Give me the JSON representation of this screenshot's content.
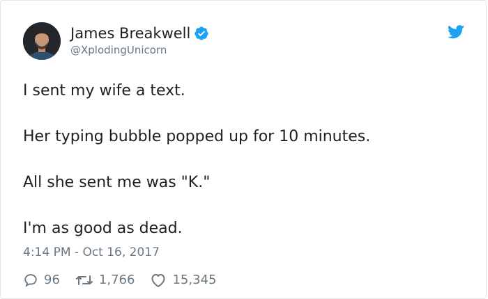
{
  "author": {
    "display_name": "James Breakwell",
    "handle": "@XplodingUnicorn",
    "verified": true
  },
  "tweet": {
    "lines": [
      "I sent my wife a text.",
      "Her typing bubble popped up for 10 minutes.",
      "All she sent me was \"K.\"",
      "I'm as good as dead."
    ],
    "timestamp": "4:14 PM - Oct 16, 2017"
  },
  "stats": {
    "replies": "96",
    "retweets": "1,766",
    "likes": "15,345"
  },
  "icons": {
    "verified": "verified-badge-icon",
    "brand": "twitter-bird-icon",
    "reply": "speech-bubble-icon",
    "retweet": "retweet-arrows-icon",
    "like": "heart-icon"
  },
  "colors": {
    "brand_blue": "#1da1f2",
    "text_primary": "#1c2022",
    "text_secondary": "#697882"
  }
}
